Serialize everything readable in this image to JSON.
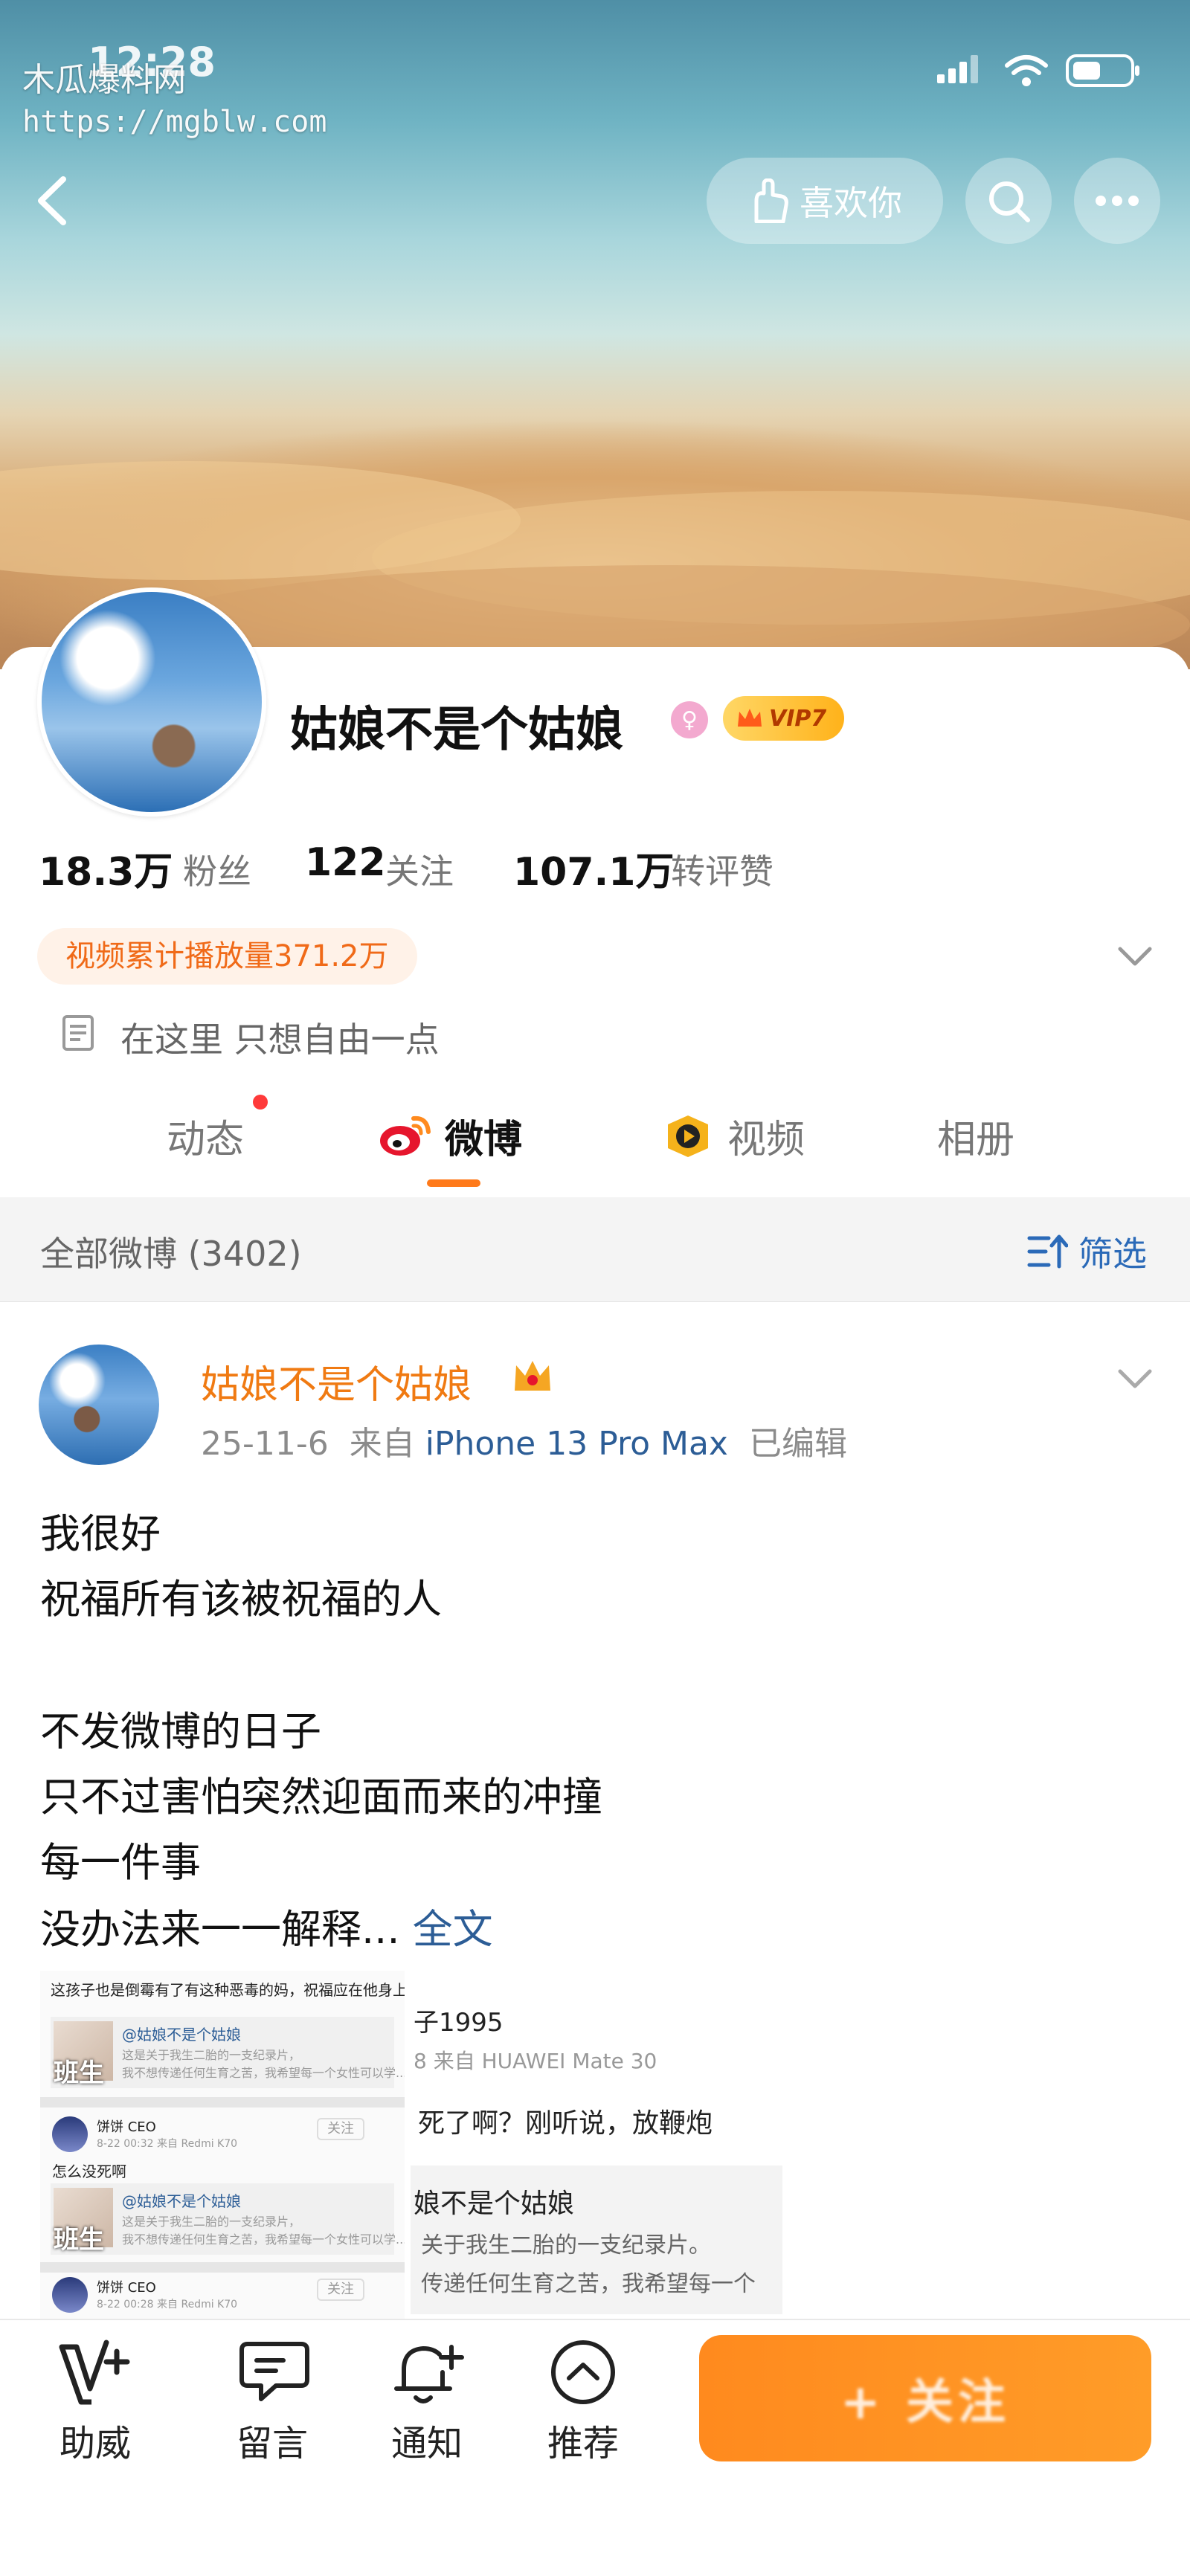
{
  "status_bar": {
    "time": "12:28"
  },
  "watermark": {
    "name": "木瓜爆料网",
    "url": "https://mgblw.com"
  },
  "header": {
    "like_label": "喜欢你",
    "icons": {
      "back": "back-arrow-icon",
      "like": "hand-heart-icon",
      "search": "search-icon",
      "more": "more-dots-icon"
    }
  },
  "profile": {
    "name": "姑娘不是个姑娘",
    "vip": "VIP7",
    "gender_badge": "female-icon",
    "stats": [
      {
        "value": "18.3万",
        "label": "粉丝"
      },
      {
        "value": "122",
        "label": "关注"
      },
      {
        "value": "107.1万",
        "label": "转评赞"
      }
    ],
    "video_views": "视频累计播放量371.2万",
    "bio": "在这里 只想自由一点"
  },
  "tabs": [
    {
      "label": "动态",
      "has_dot": true
    },
    {
      "label": "微博",
      "active": true
    },
    {
      "label": "视频"
    },
    {
      "label": "相册"
    }
  ],
  "filter": {
    "count_label": "全部微博 (3402)",
    "filter_label": "筛选"
  },
  "post": {
    "author": "姑娘不是个姑娘",
    "date": "25-11-6",
    "source_prefix": "来自",
    "device": "iPhone 13 Pro Max",
    "edited": "已编辑",
    "lines": [
      "我很好",
      "祝福所有该被祝福的人",
      "不发微博的日子",
      "只不过害怕突然迎面而来的冲撞",
      "每一件事",
      "没办法来一一解释..."
    ],
    "more_label": "全文",
    "image1": {
      "top_text": "这孩子也是倒霉有了有这种恶毒的妈，祝福应在他身上",
      "quote_name": "@姑娘不是个姑娘",
      "quote_text1": "这是关于我生二胎的一支纪录片，",
      "quote_text2": "我不想传递任何生育之苦，我希望每一个女性可以学...",
      "pic_tag": "班生",
      "commenter": "饼饼 CEO",
      "commenter_meta": "8-22 00:32 来自 Redmi K70",
      "follow_small": "关注",
      "comment2": "怎么没死啊",
      "commenter2": "饼饼 CEO",
      "commenter2_meta": "8-22 00:28 来自 Redmi K70"
    },
    "image2": {
      "name_partial": "子1995",
      "meta_partial": "8 来自 HUAWEI Mate 30",
      "text_partial": "死了啊？刚听说，放鞭炮",
      "quote_name": "娘不是个姑娘",
      "quote_text1": "关于我生二胎的一支纪录片。",
      "quote_text2": "传递任何生育之苦，我希望每一个"
    }
  },
  "bottom_bar": {
    "items": [
      {
        "label": "助威",
        "icon": "v-plus-icon"
      },
      {
        "label": "留言",
        "icon": "message-icon"
      },
      {
        "label": "通知",
        "icon": "bell-plus-icon"
      },
      {
        "label": "推荐",
        "icon": "chevron-circle-icon"
      }
    ],
    "follow_label": "+ 关注"
  },
  "colors": {
    "accent": "#ff8a1e",
    "link": "#2c5d96",
    "author": "#f07a12"
  }
}
